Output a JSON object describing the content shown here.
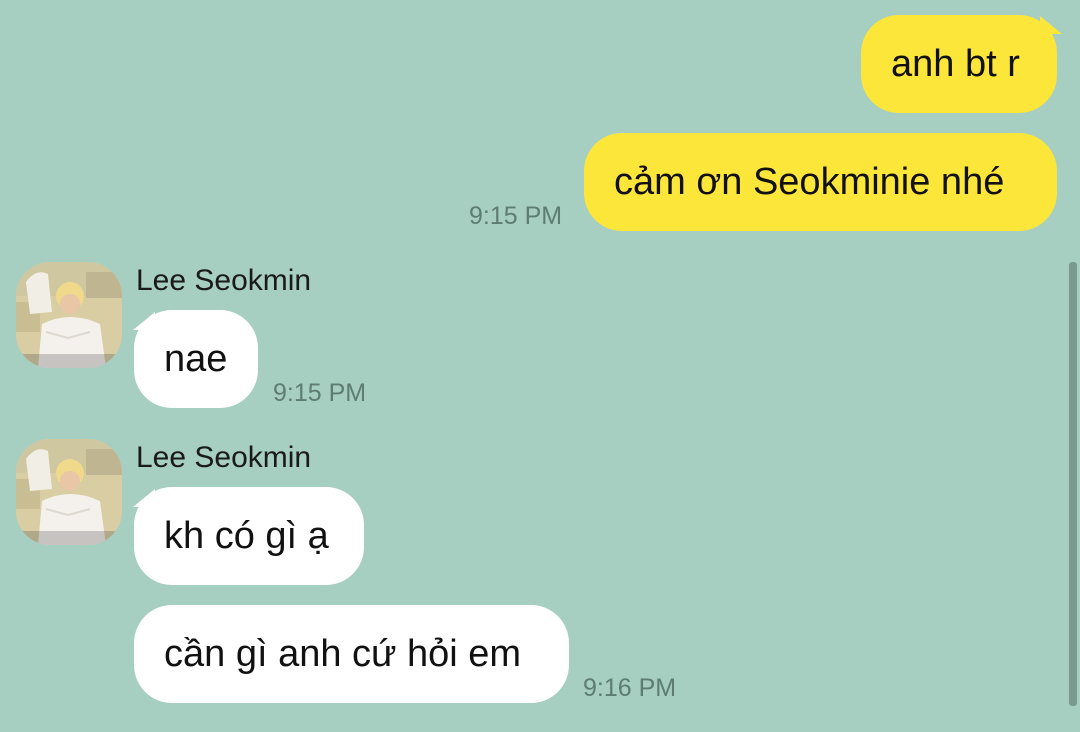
{
  "colors": {
    "background": "#a6cec1",
    "outgoing_bubble": "#fde63a",
    "incoming_bubble": "#ffffff",
    "timestamp": "#5d7d73"
  },
  "messages": {
    "out_1": {
      "text": "anh bt r"
    },
    "out_2": {
      "text": "cảm ơn Seokminie nhé",
      "time": "9:15 PM"
    },
    "in_group_1": {
      "sender": "Lee Seokmin",
      "avatar_icon": "profile-photo",
      "msg_1": {
        "text": "nae",
        "time": "9:15 PM"
      }
    },
    "in_group_2": {
      "sender": "Lee Seokmin",
      "avatar_icon": "profile-photo",
      "msg_1": {
        "text": "kh có gì ạ"
      },
      "msg_2": {
        "text": "cần gì anh cứ hỏi em",
        "time": "9:16 PM"
      }
    }
  }
}
